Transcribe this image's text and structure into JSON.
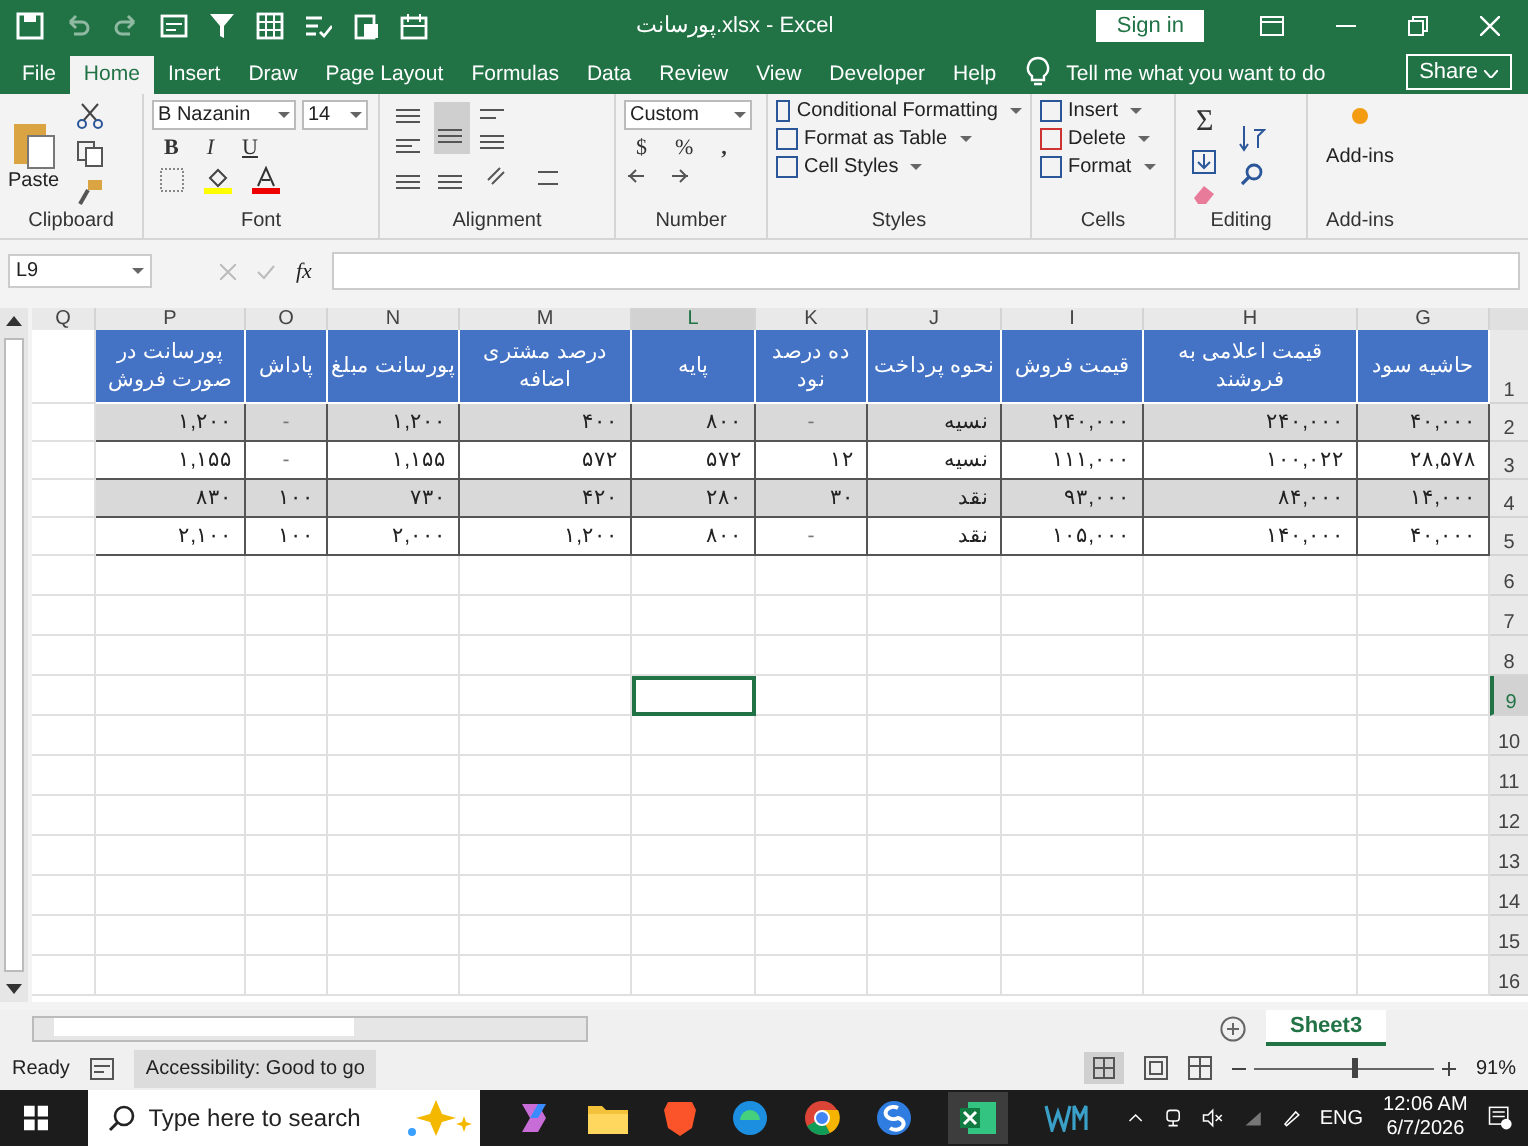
{
  "window": {
    "title": "پورسانت.xlsx - Excel",
    "sign_in": "Sign in"
  },
  "ribbon_tabs": {
    "file": {
      "label": "File",
      "selected": false
    },
    "home": {
      "label": "Home",
      "selected": true
    },
    "insert": {
      "label": "Insert",
      "selected": false
    },
    "draw": {
      "label": "Draw",
      "selected": false
    },
    "page_layout": {
      "label": "Page Layout",
      "selected": false
    },
    "formulas": {
      "label": "Formulas",
      "selected": false
    },
    "data": {
      "label": "Data",
      "selected": false
    },
    "review": {
      "label": "Review",
      "selected": false
    },
    "view": {
      "label": "View",
      "selected": false
    },
    "developer": {
      "label": "Developer",
      "selected": false
    },
    "help": {
      "label": "Help",
      "selected": false
    }
  },
  "tell_me": "Tell me what you want to do",
  "share": "Share",
  "ribbon": {
    "paste": "Paste",
    "font_name": "B Nazanin",
    "font_size": "14",
    "bold": "B",
    "italic": "I",
    "underline": "U",
    "number_format": "Custom",
    "currency": "$",
    "percent": "%",
    "comma": ",",
    "conditional_formatting": "Conditional Formatting",
    "format_as_table": "Format as Table",
    "cell_styles": "Cell Styles",
    "insert": "Insert",
    "delete": "Delete",
    "format": "Format",
    "sum": "Σ",
    "add_ins": "Add-ins",
    "groups": {
      "clipboard": "Clipboard",
      "font": "Font",
      "alignment": "Alignment",
      "number": "Number",
      "styles": "Styles",
      "cells": "Cells",
      "editing": "Editing",
      "add_ins": "Add-ins"
    }
  },
  "name_box": "L9",
  "fx": "fx",
  "header_row": "1",
  "columns": [
    {
      "letter": "G",
      "header": "حاشیه سود",
      "selected": false
    },
    {
      "letter": "H",
      "header": "قیمت اعلامی به فروشند",
      "selected": false
    },
    {
      "letter": "I",
      "header": "قیمت فروش",
      "selected": false
    },
    {
      "letter": "J",
      "header": "نحوه پرداخت",
      "selected": false
    },
    {
      "letter": "K",
      "header": "ده درصد نود",
      "selected": false
    },
    {
      "letter": "L",
      "header": "پایه",
      "selected": true
    },
    {
      "letter": "M",
      "header": "درصد مشتری اضافه",
      "selected": false
    },
    {
      "letter": "N",
      "header": "پورسانت مبلغ",
      "selected": false
    },
    {
      "letter": "O",
      "header": "پاداش",
      "selected": false
    },
    {
      "letter": "P",
      "header": "پورسانت در صورت فروش",
      "selected": false
    },
    {
      "letter": "Q",
      "selected": false
    }
  ],
  "rows": [
    {
      "number": "2",
      "shaded": true,
      "cells": [
        "۴۰,۰۰۰",
        "۲۴۰,۰۰۰",
        "۲۴۰,۰۰۰",
        "نسیه",
        "-",
        "۸۰۰",
        "۴۰۰",
        "۱,۲۰۰",
        "-",
        "۱,۲۰۰",
        ""
      ]
    },
    {
      "number": "3",
      "shaded": false,
      "cells": [
        "۲۸,۵۷۸",
        "۱۰۰,۰۲۲",
        "۱۱۱,۰۰۰",
        "نسیه",
        "۱۲",
        "۵۷۲",
        "۵۷۲",
        "۱,۱۵۵",
        "-",
        "۱,۱۵۵",
        ""
      ]
    },
    {
      "number": "4",
      "shaded": true,
      "cells": [
        "۱۴,۰۰۰",
        "۸۴,۰۰۰",
        "۹۳,۰۰۰",
        "نقد",
        "۳۰",
        "۲۸۰",
        "۴۲۰",
        "۷۳۰",
        "۱۰۰",
        "۸۳۰",
        ""
      ]
    },
    {
      "number": "5",
      "shaded": false,
      "cells": [
        "۴۰,۰۰۰",
        "۱۴۰,۰۰۰",
        "۱۰۵,۰۰۰",
        "نقد",
        "-",
        "۸۰۰",
        "۱,۲۰۰",
        "۲,۰۰۰",
        "۱۰۰",
        "۲,۱۰۰",
        ""
      ]
    }
  ],
  "empty_rows": [
    {
      "number": "6",
      "selected": false
    },
    {
      "number": "7",
      "selected": false
    },
    {
      "number": "8",
      "selected": false
    },
    {
      "number": "9",
      "selected": true
    },
    {
      "number": "10",
      "selected": false
    },
    {
      "number": "11",
      "selected": false
    },
    {
      "number": "12",
      "selected": false
    },
    {
      "number": "13",
      "selected": false
    },
    {
      "number": "14",
      "selected": false
    },
    {
      "number": "15",
      "selected": false
    },
    {
      "number": "16",
      "selected": false
    }
  ],
  "sheet_tabs": [
    {
      "label": "Sheet3",
      "selected": true
    }
  ],
  "status_bar": {
    "ready": "Ready",
    "accessibility": "Accessibility: Good to go",
    "zoom": "91%",
    "zoom_slider": {
      "level": 0.55
    }
  },
  "taskbar": {
    "search_placeholder": "Type here to search",
    "language": "ENG",
    "time": "12:06 AM",
    "date": "6/7/2026"
  }
}
